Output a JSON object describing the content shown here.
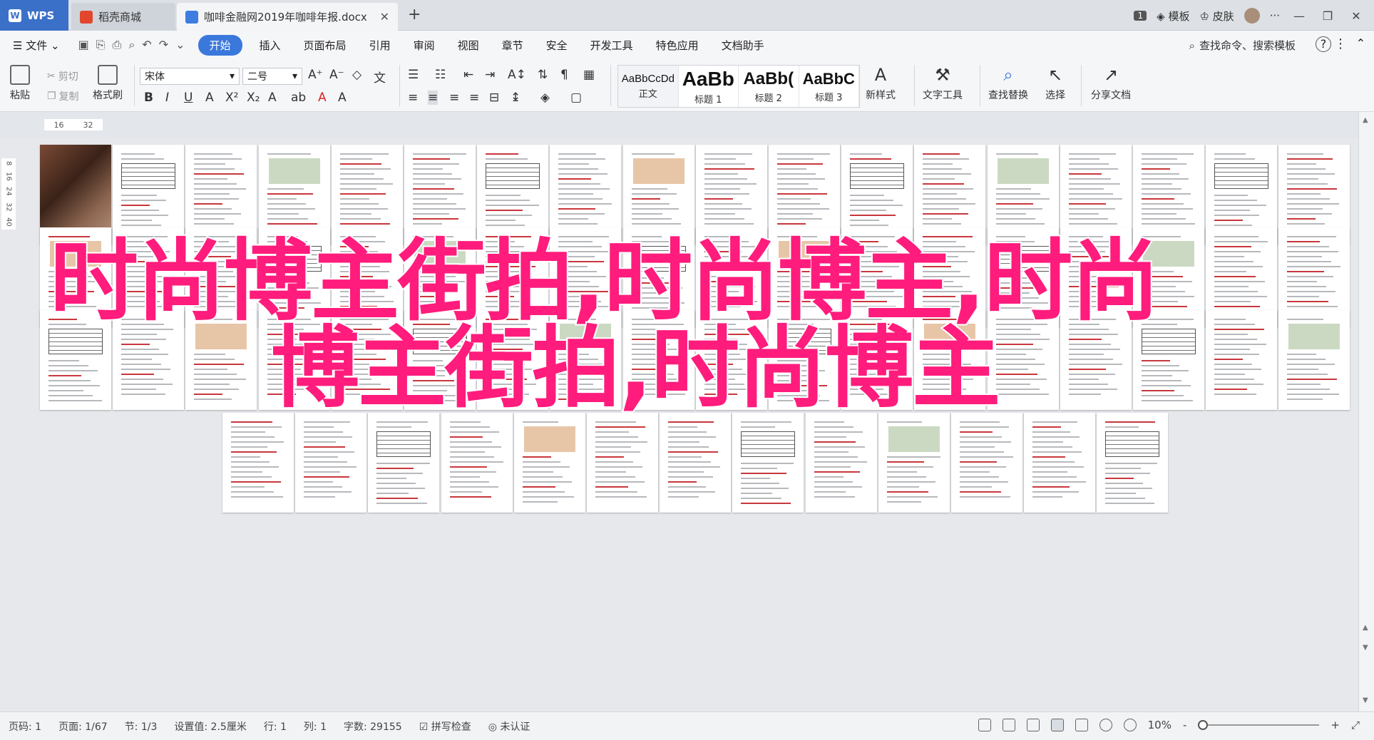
{
  "tabs": {
    "wps": "WPS",
    "shop": "稻壳商城",
    "doc": "咖啡金融网2019年咖啡年报.docx",
    "close": "✕",
    "add": "+"
  },
  "titlebar_right": {
    "badge": "1",
    "template": "模板",
    "skin": "皮肤",
    "dots": "···"
  },
  "menu": {
    "file": "文件",
    "items": [
      "开始",
      "插入",
      "页面布局",
      "引用",
      "审阅",
      "视图",
      "章节",
      "安全",
      "开发工具",
      "特色应用",
      "文档助手"
    ],
    "search": "查找命令、搜索模板",
    "help": "?"
  },
  "ribbon": {
    "paste": "粘贴",
    "cut": "剪切",
    "copy": "复制",
    "format_painter": "格式刷",
    "font_name": "宋体",
    "font_size": "二号",
    "styles": [
      {
        "sample": "AaBbCcDd",
        "label": "正文"
      },
      {
        "sample": "AaBb",
        "label": "标题 1"
      },
      {
        "sample": "AaBb(",
        "label": "标题 2"
      },
      {
        "sample": "AaBbC",
        "label": "标题 3"
      }
    ],
    "new_style": "新样式",
    "text_tools": "文字工具",
    "find_replace": "查找替换",
    "select": "选择",
    "share": "分享文档"
  },
  "ruler": {
    "h_marks": [
      "16",
      "32"
    ],
    "v_marks": [
      "8",
      "16",
      "24",
      "32",
      "40"
    ]
  },
  "overlay": {
    "line1": "时尚博主街拍,时尚博主,时尚",
    "line2": "博主街拍,时尚博主"
  },
  "status": {
    "page": "页码: 1",
    "pages": "页面: 1/67",
    "section": "节: 1/3",
    "setting": "设置值: 2.5厘米",
    "row": "行: 1",
    "col": "列: 1",
    "words": "字数: 29155",
    "spell": "拼写检查",
    "cert": "未认证",
    "zoom": "10%",
    "minus": "-",
    "plus": "+"
  },
  "colors": {
    "accent": "#3a78dc",
    "overlay_text": "#ff1c7c"
  }
}
